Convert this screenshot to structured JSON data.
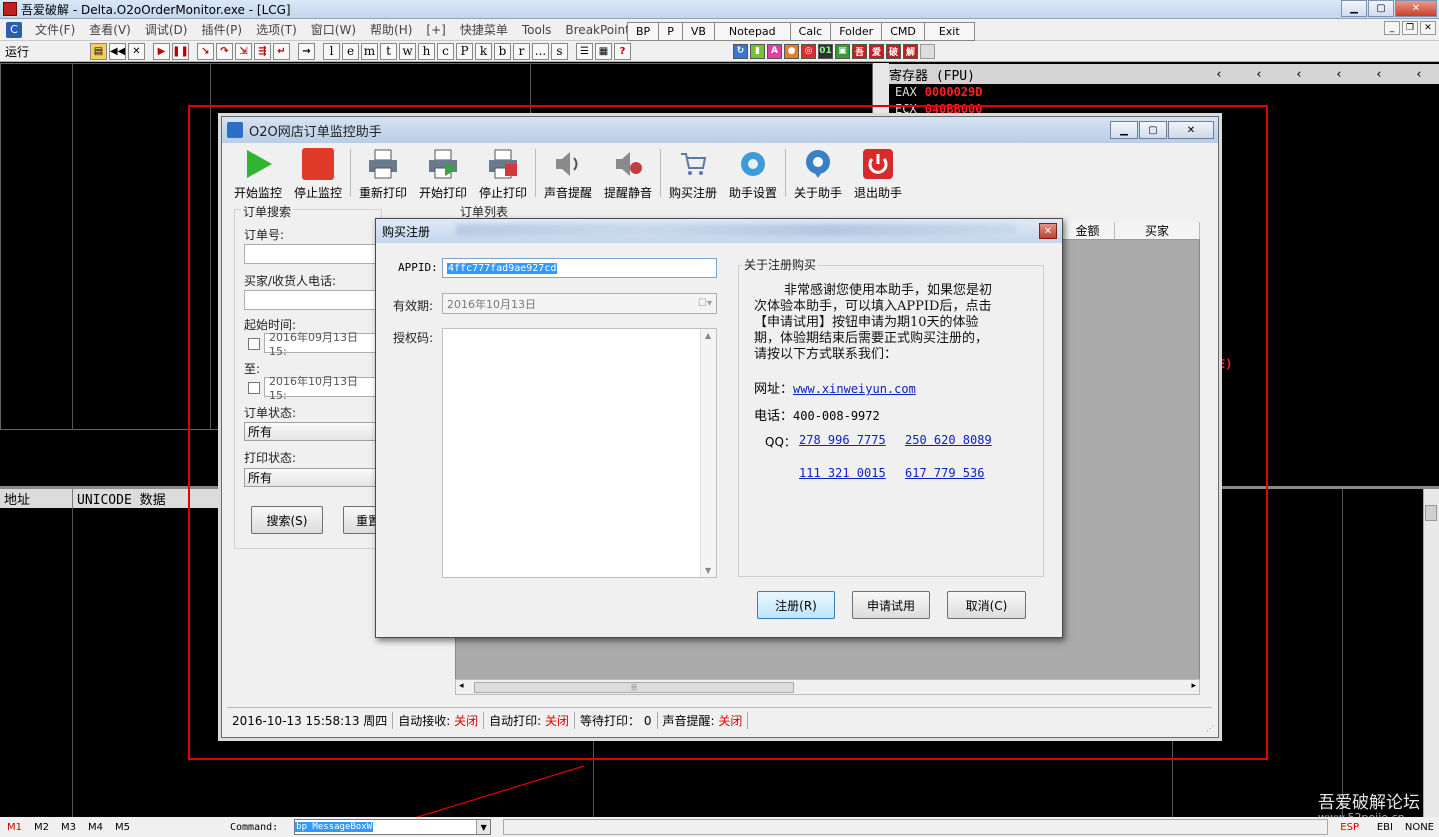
{
  "debugger": {
    "title": "吾爱破解 - Delta.O2oOrderMonitor.exe - [LCG]",
    "menu": [
      "文件(F)",
      "查看(V)",
      "调试(D)",
      "插件(P)",
      "选项(T)",
      "窗口(W)",
      "帮助(H)",
      "[+]",
      "快捷菜单",
      "Tools",
      "BreakPoint->"
    ],
    "quick_buttons": [
      "BP",
      "P",
      "VB",
      "Notepad",
      "Calc",
      "Folder",
      "CMD",
      "Exit"
    ],
    "status": "运行",
    "letter_buttons": [
      "l",
      "e",
      "m",
      "t",
      "w",
      "h",
      "c",
      "P",
      "k",
      "b",
      "r",
      "...",
      "s"
    ],
    "plugin_labels": [
      "吾",
      "爱",
      "破",
      "解"
    ],
    "registers_title": "寄存器 (FPU)",
    "reg_eax_name": "EAX",
    "reg_eax_value": "0000029D",
    "reg_ecx_name": "ECX",
    "reg_ecx_value": "040BB000",
    "reg_partial": "E)",
    "dump_addr_header": "地址",
    "dump_data_header": "UNICODE 数据",
    "command_label": "Command:",
    "command_value": "bp MessageBoxW",
    "m_buttons": [
      "M1",
      "M2",
      "M3",
      "M4",
      "M5"
    ],
    "status_right": [
      "ESP",
      "EBI",
      "NONE"
    ],
    "watermark": "吾爱破解论坛",
    "watermark_url": "www.52pojie.cn"
  },
  "app": {
    "title": "O2O网店订单监控助手",
    "toolbar": [
      {
        "label": "开始监控",
        "color": "#2fb52f"
      },
      {
        "label": "停止监控",
        "color": "#e03a2a"
      },
      {
        "label": "重新打印",
        "color": "#6a7a8c"
      },
      {
        "label": "开始打印",
        "color": "#3ca04a"
      },
      {
        "label": "停止打印",
        "color": "#d03a3a"
      },
      {
        "label": "声音提醒",
        "color": "#8a8a8a"
      },
      {
        "label": "提醒静音",
        "color": "#c04040"
      },
      {
        "label": "购买注册",
        "color": "#5a7aa8"
      },
      {
        "label": "助手设置",
        "color": "#3f9ad8"
      },
      {
        "label": "关于助手",
        "color": "#3a80c8"
      },
      {
        "label": "退出助手",
        "color": "#d82a2a"
      }
    ],
    "search_group": "订单搜索",
    "order_no_label": "订单号:",
    "buyer_phone_label": "买家/收货人电话:",
    "start_time_label": "起始时间:",
    "start_time_value": "2016年09月13日 15:",
    "to_label": "至:",
    "end_time_value": "2016年10月13日 15:",
    "order_status_label": "订单状态:",
    "order_status_value": "所有",
    "print_status_label": "打印状态:",
    "print_status_value": "所有",
    "search_button": "搜索(S)",
    "reset_button": "重置",
    "order_list_label": "订单列表",
    "col_amount": "金额",
    "col_buyer": "买家",
    "status": {
      "datetime": "2016-10-13 15:58:13 周四",
      "auto_receive_label": "自动接收:",
      "auto_receive_value": "关闭",
      "auto_print_label": "自动打印:",
      "auto_print_value": "关闭",
      "waiting_label": "等待打印：",
      "waiting_value": "0",
      "sound_label": "声音提醒:",
      "sound_value": "关闭"
    }
  },
  "dialog": {
    "title": "购买注册",
    "appid_label": "APPID:",
    "appid_value": "4ffc777fad9ae927cd",
    "validity_label": "有效期:",
    "validity_value": "2016年10月13日",
    "auth_label": "授权码:",
    "about_title": "关于注册购买",
    "about_lines": [
      "非常感谢您使用本助手，如果您是初",
      "次体验本助手，可以填入APPID后，点击",
      "【申请试用】按钮申请为期10天的体验",
      "期，体验期结束后需要正式购买注册的，",
      "请按以下方式联系我们："
    ],
    "website_label": "网址：",
    "website": "www.xinweiyun.com",
    "phone_label": "电话：",
    "phone": "400-008-9972",
    "qq_label": "QQ：",
    "qq_numbers": [
      "278 996 7775",
      "250 620 8089",
      "111 321 0015",
      "617 779 536"
    ],
    "register_button": "注册(R)",
    "trial_button": "申请试用",
    "cancel_button": "取消(C)"
  }
}
